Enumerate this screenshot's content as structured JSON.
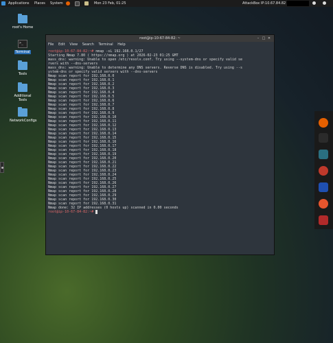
{
  "topbar": {
    "applications": "Applications",
    "places": "Places",
    "system": "System",
    "clock": "Mon 23 Feb, 01:25",
    "ip": "AttackBox IP:10.67.84.82"
  },
  "desktop": {
    "icons": [
      {
        "label": "root's Home"
      },
      {
        "label": "Terminal"
      },
      {
        "label": "Tools"
      },
      {
        "label": "Additional Tools"
      },
      {
        "label": "NetworkConfigs"
      }
    ]
  },
  "window": {
    "title": "root@ip-10-67-84-82: ~",
    "menu": [
      "File",
      "Edit",
      "View",
      "Search",
      "Terminal",
      "Help"
    ],
    "prompt": "root@ip-10-67-84-82:~#",
    "command": " nmap -sL 192.168.0.1/27",
    "output": "Starting Nmap 7.80 ( https://nmap.org ) at 2026-02-23 01:25 GMT\nmass_dns: warning: Unable to open /etc/resolv.conf. Try using --system-dns or specify valid se\nrvers with --dns-servers\nmass_dns: warning: Unable to determine any DNS servers. Reverse DNS is disabled. Try using --s\nystem-dns or specify valid servers with --dns-servers\nNmap scan report for 192.168.0.0\nNmap scan report for 192.168.0.1\nNmap scan report for 192.168.0.2\nNmap scan report for 192.168.0.3\nNmap scan report for 192.168.0.4\nNmap scan report for 192.168.0.5\nNmap scan report for 192.168.0.6\nNmap scan report for 192.168.0.7\nNmap scan report for 192.168.0.8\nNmap scan report for 192.168.0.9\nNmap scan report for 192.168.0.10\nNmap scan report for 192.168.0.11\nNmap scan report for 192.168.0.12\nNmap scan report for 192.168.0.13\nNmap scan report for 192.168.0.14\nNmap scan report for 192.168.0.15\nNmap scan report for 192.168.0.16\nNmap scan report for 192.168.0.17\nNmap scan report for 192.168.0.18\nNmap scan report for 192.168.0.19\nNmap scan report for 192.168.0.20\nNmap scan report for 192.168.0.21\nNmap scan report for 192.168.0.22\nNmap scan report for 192.168.0.23\nNmap scan report for 192.168.0.24\nNmap scan report for 192.168.0.25\nNmap scan report for 192.168.0.26\nNmap scan report for 192.168.0.27\nNmap scan report for 192.168.0.28\nNmap scan report for 192.168.0.29\nNmap scan report for 192.168.0.30\nNmap scan report for 192.168.0.31\nNmap done: 32 IP addresses (0 hosts up) scanned in 0.00 seconds",
    "final_prompt": "root@ip-10-67-84-82:~#"
  },
  "dock": {
    "apps": [
      {
        "icon": "firefox-icon",
        "color": "#e66000"
      },
      {
        "icon": "terminal-icon",
        "color": "#2b2b2b"
      },
      {
        "icon": "burp-icon",
        "color": "#2a6f80"
      },
      {
        "icon": "target-icon",
        "color": "#c0392b"
      },
      {
        "icon": "metasploit-icon",
        "color": "#1f4fb0"
      },
      {
        "icon": "compass-icon",
        "color": "#e8552d"
      },
      {
        "icon": "kali-dragon-icon",
        "color": "#b22a2a"
      }
    ]
  },
  "colors": {
    "prompt": "#e36a6a",
    "selection": "#2a6fb5"
  }
}
